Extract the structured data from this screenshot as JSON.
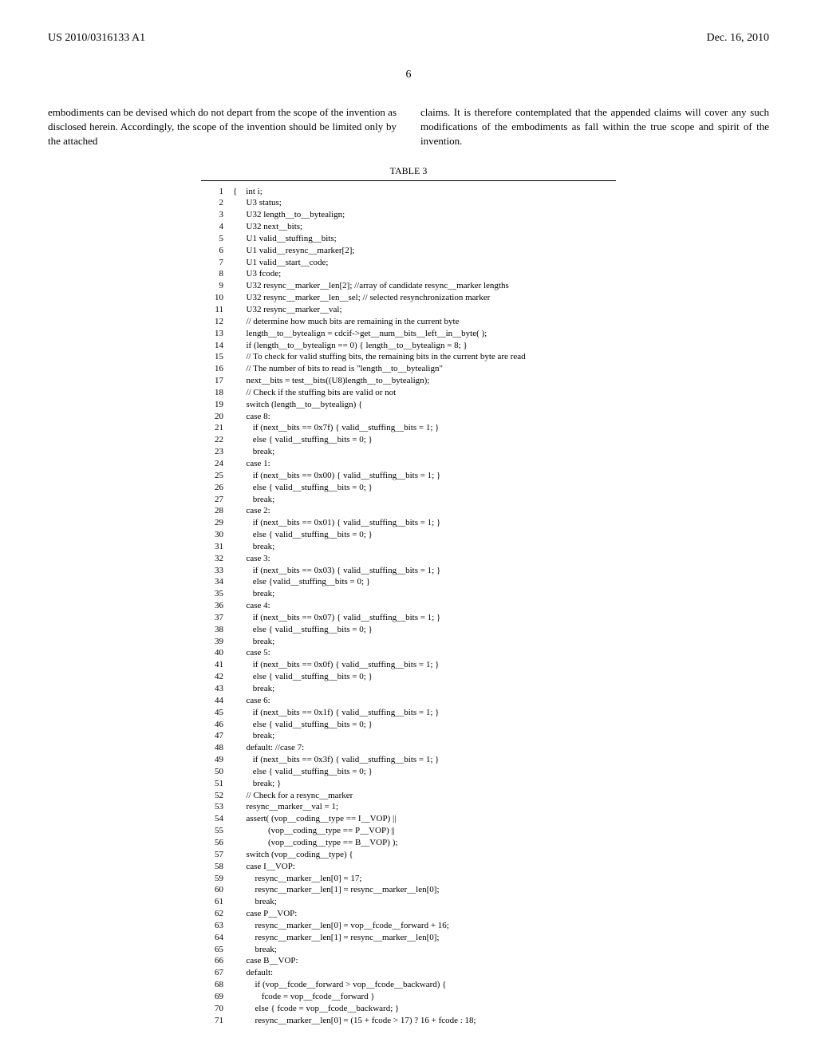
{
  "header": {
    "pub_number": "US 2010/0316133 A1",
    "pub_date": "Dec. 16, 2010"
  },
  "page_number": "6",
  "para_left": "embodiments can be devised which do not depart from the scope of the invention as disclosed herein. Accordingly, the scope of the invention should be limited only by the attached",
  "para_right": "claims. It is therefore contemplated that the appended claims will cover any such modifications of the embodiments as fall within the true scope and spirit of the invention.",
  "table_label": "TABLE 3",
  "code_lines": [
    {
      "n": "1",
      "t": "{    int i;"
    },
    {
      "n": "2",
      "t": "      U3 status;"
    },
    {
      "n": "3",
      "t": "      U32 length__to__bytealign;"
    },
    {
      "n": "4",
      "t": "      U32 next__bits;"
    },
    {
      "n": "5",
      "t": "      U1 valid__stuffing__bits;"
    },
    {
      "n": "6",
      "t": "      U1 valid__resync__marker[2];"
    },
    {
      "n": "7",
      "t": "      U1 valid__start__code;"
    },
    {
      "n": "8",
      "t": "      U3 fcode;"
    },
    {
      "n": "9",
      "t": "      U32 resync__marker__len[2]; //array of candidate resync__marker lengths"
    },
    {
      "n": "10",
      "t": "      U32 resync__marker__len__sel; // selected resynchronization marker"
    },
    {
      "n": "11",
      "t": "      U32 resync__marker__val;"
    },
    {
      "n": "12",
      "t": "      // determine how much bits are remaining in the current byte"
    },
    {
      "n": "13",
      "t": "      length__to__bytealign = cdcif->get__num__bits__left__in__byte( );"
    },
    {
      "n": "14",
      "t": "      if (length__to__bytealign == 0) { length__to__bytealign = 8; }"
    },
    {
      "n": "15",
      "t": "      // To check for valid stuffing bits, the remaining bits in the current byte are read"
    },
    {
      "n": "16",
      "t": "      // The number of bits to read is \"length__to__bytealign\""
    },
    {
      "n": "17",
      "t": "      next__bits = test__bits((U8)length__to__bytealign);"
    },
    {
      "n": "18",
      "t": "      // Check if the stuffing bits are valid or not"
    },
    {
      "n": "19",
      "t": "      switch (length__to__bytealign) {"
    },
    {
      "n": "20",
      "t": "      case 8:"
    },
    {
      "n": "21",
      "t": "         if (next__bits == 0x7f) { valid__stuffing__bits = 1; }"
    },
    {
      "n": "22",
      "t": "         else { valid__stuffing__bits = 0; }"
    },
    {
      "n": "23",
      "t": "         break;"
    },
    {
      "n": "24",
      "t": "      case 1:"
    },
    {
      "n": "25",
      "t": "         if (next__bits == 0x00) { valid__stuffing__bits = 1; }"
    },
    {
      "n": "26",
      "t": "         else { valid__stuffing__bits = 0; }"
    },
    {
      "n": "27",
      "t": "         break;"
    },
    {
      "n": "28",
      "t": "      case 2:"
    },
    {
      "n": "29",
      "t": "         if (next__bits == 0x01) { valid__stuffing__bits = 1; }"
    },
    {
      "n": "30",
      "t": "         else { valid__stuffing__bits = 0; }"
    },
    {
      "n": "31",
      "t": "         break;"
    },
    {
      "n": "32",
      "t": "      case 3:"
    },
    {
      "n": "33",
      "t": "         if (next__bits == 0x03) { valid__stuffing__bits = 1; }"
    },
    {
      "n": "34",
      "t": "         else {valid__stuffing__bits = 0; }"
    },
    {
      "n": "35",
      "t": "         break;"
    },
    {
      "n": "36",
      "t": "      case 4:"
    },
    {
      "n": "37",
      "t": "         if (next__bits == 0x07) { valid__stuffing__bits = 1; }"
    },
    {
      "n": "38",
      "t": "         else { valid__stuffing__bits = 0; }"
    },
    {
      "n": "39",
      "t": "         break;"
    },
    {
      "n": "40",
      "t": "      case 5:"
    },
    {
      "n": "41",
      "t": "         if (next__bits == 0x0f) { valid__stuffing__bits = 1; }"
    },
    {
      "n": "42",
      "t": "         else { valid__stuffing__bits = 0; }"
    },
    {
      "n": "43",
      "t": "         break;"
    },
    {
      "n": "44",
      "t": "      case 6:"
    },
    {
      "n": "45",
      "t": "         if (next__bits == 0x1f) { valid__stuffing__bits = 1; }"
    },
    {
      "n": "46",
      "t": "         else { valid__stuffing__bits = 0; }"
    },
    {
      "n": "47",
      "t": "         break;"
    },
    {
      "n": "48",
      "t": "      default: //case 7:"
    },
    {
      "n": "49",
      "t": "         if (next__bits == 0x3f) { valid__stuffing__bits = 1; }"
    },
    {
      "n": "50",
      "t": "         else { valid__stuffing__bits = 0; }"
    },
    {
      "n": "51",
      "t": "         break; }"
    },
    {
      "n": "52",
      "t": "      // Check for a resync__marker"
    },
    {
      "n": "53",
      "t": "      resync__marker__val = 1;"
    },
    {
      "n": "54",
      "t": "      assert( (vop__coding__type == I__VOP) ||"
    },
    {
      "n": "55",
      "t": "                (vop__coding__type == P__VOP) ||"
    },
    {
      "n": "56",
      "t": "                (vop__coding__type == B__VOP) );"
    },
    {
      "n": "57",
      "t": "      switch (vop__coding__type) {"
    },
    {
      "n": "58",
      "t": "      case I__VOP:"
    },
    {
      "n": "59",
      "t": "          resync__marker__len[0] = 17;"
    },
    {
      "n": "60",
      "t": "          resync__marker__len[1] = resync__marker__len[0];"
    },
    {
      "n": "61",
      "t": "          break;"
    },
    {
      "n": "62",
      "t": "      case P__VOP:"
    },
    {
      "n": "63",
      "t": "          resync__marker__len[0] = vop__fcode__forward + 16;"
    },
    {
      "n": "64",
      "t": "          resync__marker__len[1] = resync__marker__len[0];"
    },
    {
      "n": "65",
      "t": "          break;"
    },
    {
      "n": "66",
      "t": "      case B__VOP:"
    },
    {
      "n": "67",
      "t": "      default:"
    },
    {
      "n": "68",
      "t": "          if (vop__fcode__forward > vop__fcode__backward) {"
    },
    {
      "n": "69",
      "t": "             fcode = vop__fcode__forward }"
    },
    {
      "n": "70",
      "t": "          else { fcode = vop__fcode__backward; }"
    },
    {
      "n": "71",
      "t": "          resync__marker__len[0] = (15 + fcode > 17) ? 16 + fcode : 18;"
    }
  ]
}
